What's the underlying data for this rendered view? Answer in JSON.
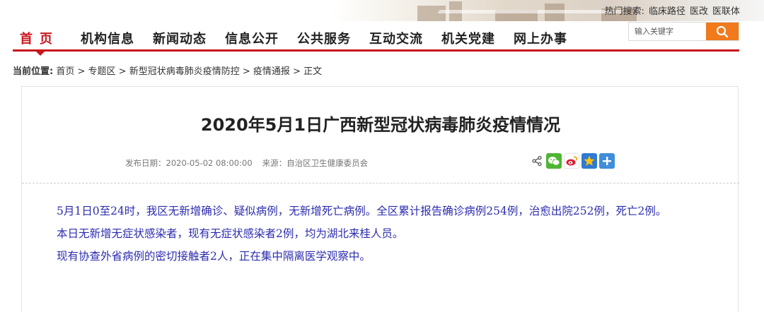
{
  "hot_links": {
    "label": "热门搜索:",
    "items": [
      "临床路径",
      "医改",
      "医联体"
    ]
  },
  "nav": {
    "items": [
      "首页",
      "机构信息",
      "新闻动态",
      "信息公开",
      "公共服务",
      "互动交流",
      "机关党建",
      "网上办事"
    ],
    "active": 0
  },
  "search": {
    "placeholder": "输入关键字"
  },
  "breadcrumb": {
    "label": "当前位置:",
    "items": [
      "首页",
      "专题区",
      "新型冠状病毒肺炎疫情防控",
      "疫情通报",
      "正文"
    ],
    "separator": " > "
  },
  "article": {
    "title": "2020年5月1日广西新型冠状病毒肺炎疫情情况",
    "date": "发布日期：2020-05-02 08:00:00",
    "source": "来源：自治区卫生健康委员会",
    "paragraphs": [
      "5月1日0至24时，我区无新增确诊、疑似病例，无新增死亡病例。全区累计报告确诊病例254例，治愈出院252例，死亡2例。",
      "本日无新增无症状感染者，现有无症状感染者2例，均为湖北来桂人员。",
      "现有协查外省病例的密切接触者2人，正在集中隔离医学观察中。"
    ]
  },
  "share_icons": [
    "share-icon",
    "wechat-icon",
    "weibo-icon",
    "qzone-star-icon",
    "more-plus-icon"
  ],
  "colors": {
    "nav_accent": "#c8161d",
    "search_button": "#f07a1c",
    "body_text": "#2c2cb0"
  }
}
